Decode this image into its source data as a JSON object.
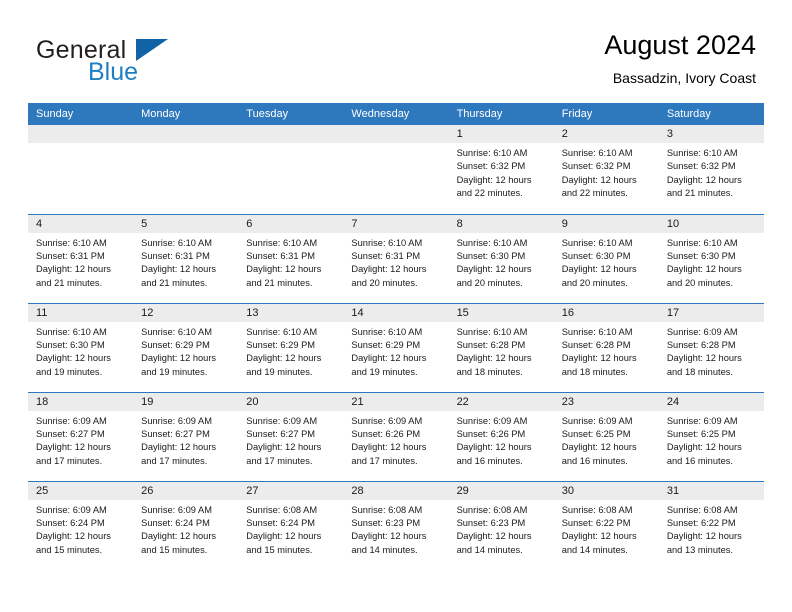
{
  "brand": {
    "word1": "General",
    "word2": "Blue",
    "accent_color": "#1263a6",
    "blue_text_color": "#1f7fc4"
  },
  "header": {
    "title": "August 2024",
    "subtitle": "Bassadzin, Ivory Coast",
    "header_bg": "#2e78bd",
    "daynum_bg": "#ececec"
  },
  "weekday_headers": [
    "Sunday",
    "Monday",
    "Tuesday",
    "Wednesday",
    "Thursday",
    "Friday",
    "Saturday"
  ],
  "weeks": [
    [
      {
        "day": "",
        "empty": true,
        "lines": []
      },
      {
        "day": "",
        "empty": true,
        "lines": []
      },
      {
        "day": "",
        "empty": true,
        "lines": []
      },
      {
        "day": "",
        "empty": true,
        "lines": []
      },
      {
        "day": "1",
        "empty": false,
        "lines": [
          "Sunrise: 6:10 AM",
          "Sunset: 6:32 PM",
          "Daylight: 12 hours",
          "and 22 minutes."
        ]
      },
      {
        "day": "2",
        "empty": false,
        "lines": [
          "Sunrise: 6:10 AM",
          "Sunset: 6:32 PM",
          "Daylight: 12 hours",
          "and 22 minutes."
        ]
      },
      {
        "day": "3",
        "empty": false,
        "lines": [
          "Sunrise: 6:10 AM",
          "Sunset: 6:32 PM",
          "Daylight: 12 hours",
          "and 21 minutes."
        ]
      }
    ],
    [
      {
        "day": "4",
        "empty": false,
        "lines": [
          "Sunrise: 6:10 AM",
          "Sunset: 6:31 PM",
          "Daylight: 12 hours",
          "and 21 minutes."
        ]
      },
      {
        "day": "5",
        "empty": false,
        "lines": [
          "Sunrise: 6:10 AM",
          "Sunset: 6:31 PM",
          "Daylight: 12 hours",
          "and 21 minutes."
        ]
      },
      {
        "day": "6",
        "empty": false,
        "lines": [
          "Sunrise: 6:10 AM",
          "Sunset: 6:31 PM",
          "Daylight: 12 hours",
          "and 21 minutes."
        ]
      },
      {
        "day": "7",
        "empty": false,
        "lines": [
          "Sunrise: 6:10 AM",
          "Sunset: 6:31 PM",
          "Daylight: 12 hours",
          "and 20 minutes."
        ]
      },
      {
        "day": "8",
        "empty": false,
        "lines": [
          "Sunrise: 6:10 AM",
          "Sunset: 6:30 PM",
          "Daylight: 12 hours",
          "and 20 minutes."
        ]
      },
      {
        "day": "9",
        "empty": false,
        "lines": [
          "Sunrise: 6:10 AM",
          "Sunset: 6:30 PM",
          "Daylight: 12 hours",
          "and 20 minutes."
        ]
      },
      {
        "day": "10",
        "empty": false,
        "lines": [
          "Sunrise: 6:10 AM",
          "Sunset: 6:30 PM",
          "Daylight: 12 hours",
          "and 20 minutes."
        ]
      }
    ],
    [
      {
        "day": "11",
        "empty": false,
        "lines": [
          "Sunrise: 6:10 AM",
          "Sunset: 6:30 PM",
          "Daylight: 12 hours",
          "and 19 minutes."
        ]
      },
      {
        "day": "12",
        "empty": false,
        "lines": [
          "Sunrise: 6:10 AM",
          "Sunset: 6:29 PM",
          "Daylight: 12 hours",
          "and 19 minutes."
        ]
      },
      {
        "day": "13",
        "empty": false,
        "lines": [
          "Sunrise: 6:10 AM",
          "Sunset: 6:29 PM",
          "Daylight: 12 hours",
          "and 19 minutes."
        ]
      },
      {
        "day": "14",
        "empty": false,
        "lines": [
          "Sunrise: 6:10 AM",
          "Sunset: 6:29 PM",
          "Daylight: 12 hours",
          "and 19 minutes."
        ]
      },
      {
        "day": "15",
        "empty": false,
        "lines": [
          "Sunrise: 6:10 AM",
          "Sunset: 6:28 PM",
          "Daylight: 12 hours",
          "and 18 minutes."
        ]
      },
      {
        "day": "16",
        "empty": false,
        "lines": [
          "Sunrise: 6:10 AM",
          "Sunset: 6:28 PM",
          "Daylight: 12 hours",
          "and 18 minutes."
        ]
      },
      {
        "day": "17",
        "empty": false,
        "lines": [
          "Sunrise: 6:09 AM",
          "Sunset: 6:28 PM",
          "Daylight: 12 hours",
          "and 18 minutes."
        ]
      }
    ],
    [
      {
        "day": "18",
        "empty": false,
        "lines": [
          "Sunrise: 6:09 AM",
          "Sunset: 6:27 PM",
          "Daylight: 12 hours",
          "and 17 minutes."
        ]
      },
      {
        "day": "19",
        "empty": false,
        "lines": [
          "Sunrise: 6:09 AM",
          "Sunset: 6:27 PM",
          "Daylight: 12 hours",
          "and 17 minutes."
        ]
      },
      {
        "day": "20",
        "empty": false,
        "lines": [
          "Sunrise: 6:09 AM",
          "Sunset: 6:27 PM",
          "Daylight: 12 hours",
          "and 17 minutes."
        ]
      },
      {
        "day": "21",
        "empty": false,
        "lines": [
          "Sunrise: 6:09 AM",
          "Sunset: 6:26 PM",
          "Daylight: 12 hours",
          "and 17 minutes."
        ]
      },
      {
        "day": "22",
        "empty": false,
        "lines": [
          "Sunrise: 6:09 AM",
          "Sunset: 6:26 PM",
          "Daylight: 12 hours",
          "and 16 minutes."
        ]
      },
      {
        "day": "23",
        "empty": false,
        "lines": [
          "Sunrise: 6:09 AM",
          "Sunset: 6:25 PM",
          "Daylight: 12 hours",
          "and 16 minutes."
        ]
      },
      {
        "day": "24",
        "empty": false,
        "lines": [
          "Sunrise: 6:09 AM",
          "Sunset: 6:25 PM",
          "Daylight: 12 hours",
          "and 16 minutes."
        ]
      }
    ],
    [
      {
        "day": "25",
        "empty": false,
        "lines": [
          "Sunrise: 6:09 AM",
          "Sunset: 6:24 PM",
          "Daylight: 12 hours",
          "and 15 minutes."
        ]
      },
      {
        "day": "26",
        "empty": false,
        "lines": [
          "Sunrise: 6:09 AM",
          "Sunset: 6:24 PM",
          "Daylight: 12 hours",
          "and 15 minutes."
        ]
      },
      {
        "day": "27",
        "empty": false,
        "lines": [
          "Sunrise: 6:08 AM",
          "Sunset: 6:24 PM",
          "Daylight: 12 hours",
          "and 15 minutes."
        ]
      },
      {
        "day": "28",
        "empty": false,
        "lines": [
          "Sunrise: 6:08 AM",
          "Sunset: 6:23 PM",
          "Daylight: 12 hours",
          "and 14 minutes."
        ]
      },
      {
        "day": "29",
        "empty": false,
        "lines": [
          "Sunrise: 6:08 AM",
          "Sunset: 6:23 PM",
          "Daylight: 12 hours",
          "and 14 minutes."
        ]
      },
      {
        "day": "30",
        "empty": false,
        "lines": [
          "Sunrise: 6:08 AM",
          "Sunset: 6:22 PM",
          "Daylight: 12 hours",
          "and 14 minutes."
        ]
      },
      {
        "day": "31",
        "empty": false,
        "lines": [
          "Sunrise: 6:08 AM",
          "Sunset: 6:22 PM",
          "Daylight: 12 hours",
          "and 13 minutes."
        ]
      }
    ]
  ]
}
